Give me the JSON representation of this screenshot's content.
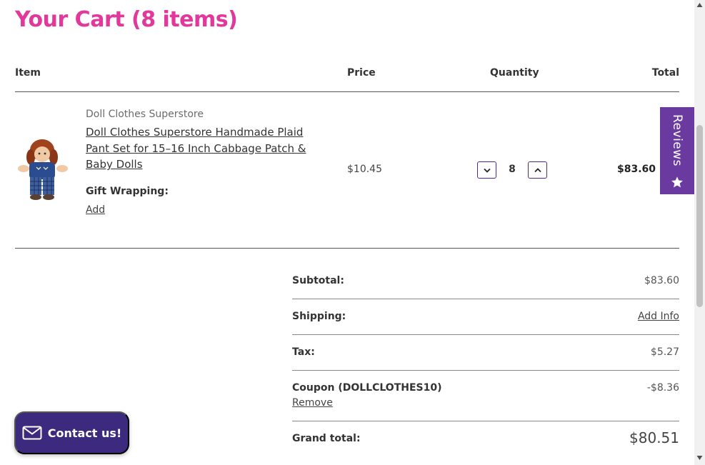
{
  "page": {
    "title": "Your Cart (8 items)"
  },
  "table": {
    "headers": {
      "item": "Item",
      "price": "Price",
      "quantity": "Quantity",
      "total": "Total"
    }
  },
  "cart_item": {
    "vendor": "Doll Clothes Superstore",
    "title": "Doll Clothes Superstore Handmade Plaid Pant Set for 15–16 Inch Cabbage Patch & Baby Dolls",
    "gift_wrapping_label": "Gift Wrapping:",
    "gift_wrapping_action": "Add",
    "unit_price": "$10.45",
    "quantity": "8",
    "line_total": "$83.60",
    "decrement_icon": "chevron-down-icon",
    "increment_icon": "chevron-up-icon"
  },
  "reviews_tab": {
    "label": "Reviews",
    "icon": "star-icon"
  },
  "summary": {
    "subtotal_label": "Subtotal:",
    "subtotal_value": "$83.60",
    "shipping_label": "Shipping:",
    "shipping_value": "Add Info",
    "tax_label": "Tax:",
    "tax_value": "$5.27",
    "coupon_label": "Coupon (DOLLCLOTHES10)",
    "coupon_value": "-$8.36",
    "coupon_remove": "Remove",
    "grand_total_label": "Grand total:",
    "grand_total_value": "$80.51"
  },
  "contact_button": {
    "label": "Contact us!",
    "icon": "envelope-icon"
  },
  "colors": {
    "title_pink": "#e2379b",
    "brand_purple": "#6a3aa0",
    "contact_navy": "#3b2a7d"
  }
}
